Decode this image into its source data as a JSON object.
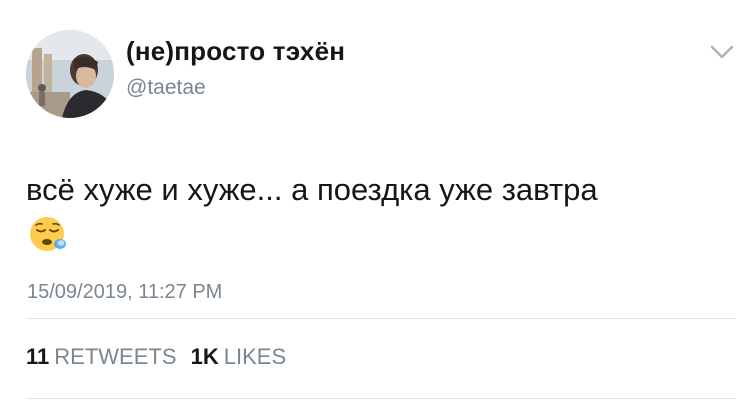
{
  "tweet": {
    "display_name": "(не)просто тэхён",
    "handle": "@taetae",
    "text": "всё хуже и хуже... а поездка уже завтра",
    "emoji": "sleepy-face",
    "timestamp": "15/09/2019, 11:27 PM",
    "retweets_count": "11",
    "retweets_label": "RETWEETS",
    "likes_count": "1K",
    "likes_label": "LIKES"
  },
  "colors": {
    "text": "#14171a",
    "secondary": "#7a8791",
    "divider": "#e1e8ed"
  }
}
